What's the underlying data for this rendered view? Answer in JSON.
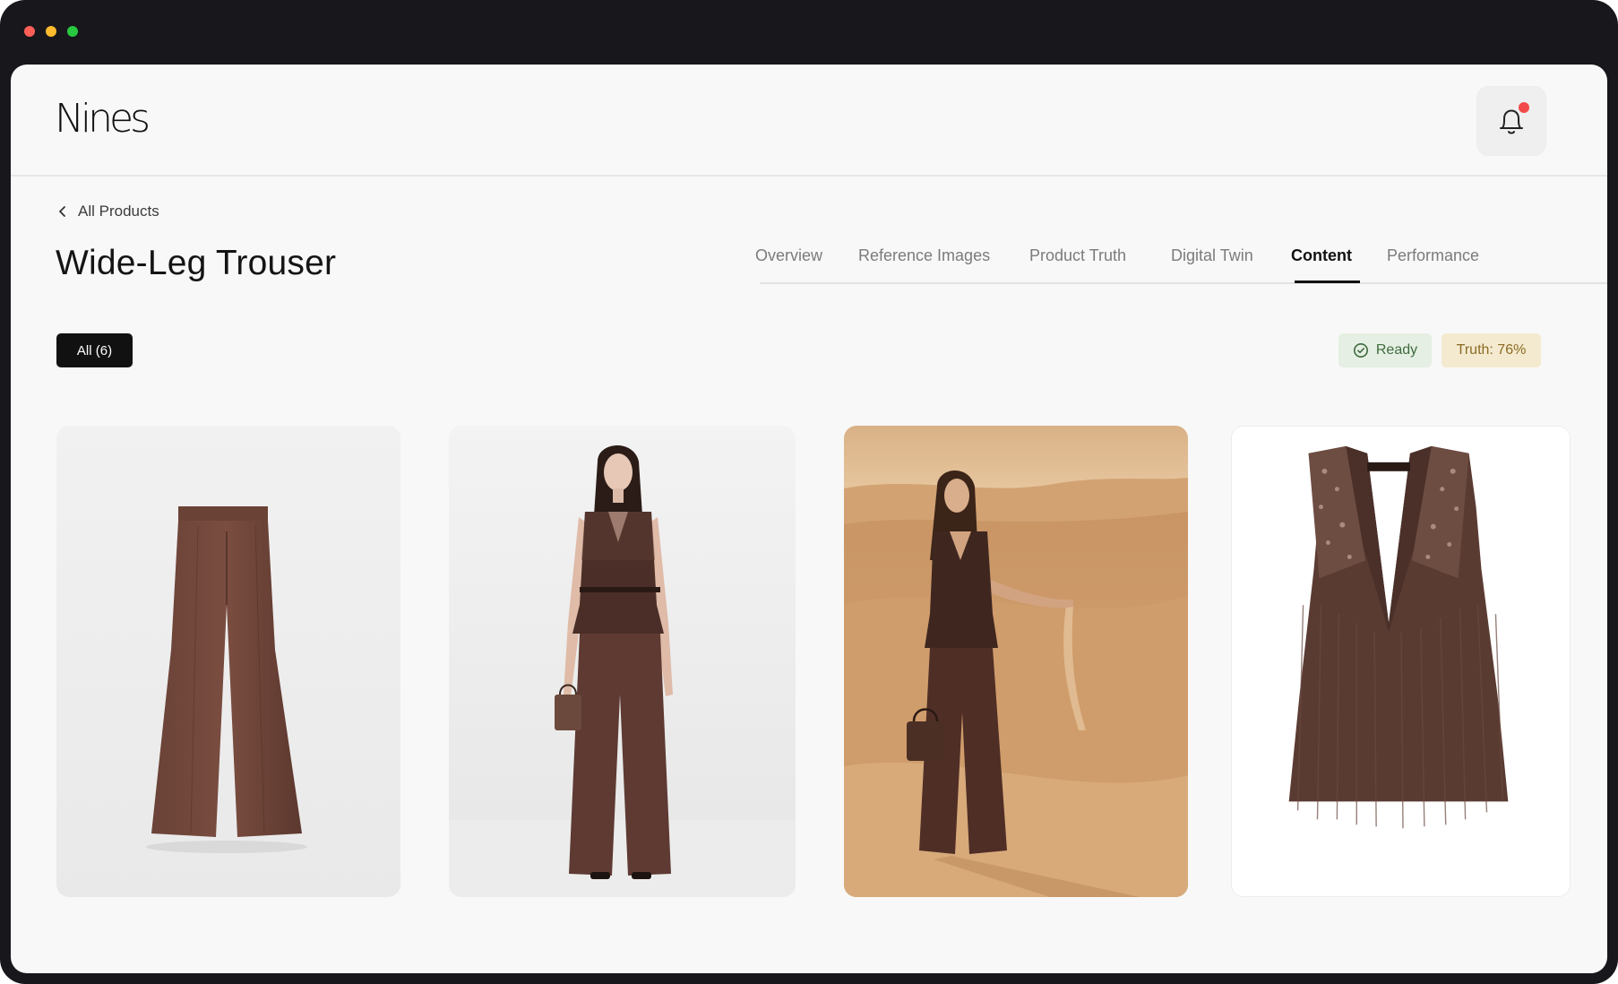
{
  "app": {
    "logo": "Nines"
  },
  "header": {
    "notifications_label": "Notifications"
  },
  "breadcrumb": {
    "label": "All Products"
  },
  "page": {
    "title": "Wide-Leg Trouser"
  },
  "tabs": [
    {
      "label": "Overview",
      "active": false
    },
    {
      "label": "Reference Images",
      "active": false
    },
    {
      "label": "Product Truth",
      "active": false
    },
    {
      "label": "Digital Twin",
      "active": false
    },
    {
      "label": "Content",
      "active": true
    },
    {
      "label": "Performance",
      "active": false
    }
  ],
  "filters": {
    "all_label": "All (6)"
  },
  "status": {
    "ready_label": "Ready",
    "truth_label": "Truth: 76%"
  },
  "gallery": [
    {
      "icon": "trouser-product-image"
    },
    {
      "icon": "studio-model-image"
    },
    {
      "icon": "desert-model-image"
    },
    {
      "icon": "feather-vest-product-image"
    }
  ],
  "colors": {
    "brown": "#5e3a32",
    "accent_dark": "#111111",
    "ready_bg": "#e5efe3",
    "truth_bg": "#f4ead0",
    "notification_dot": "#f24a4a"
  }
}
